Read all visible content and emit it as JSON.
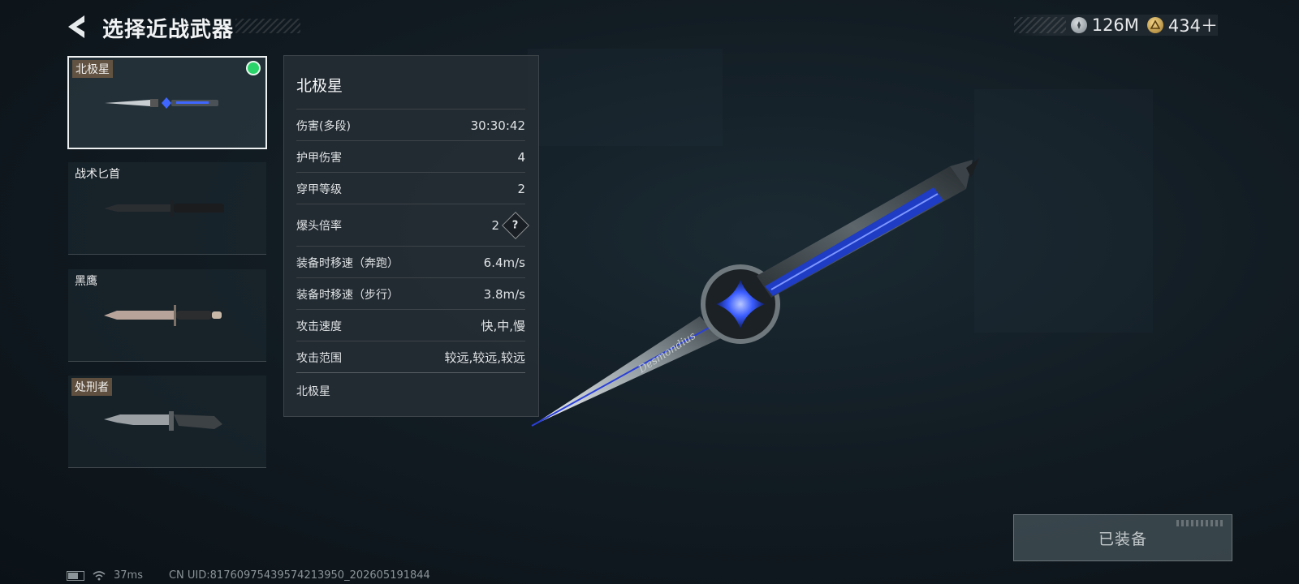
{
  "header": {
    "title": "选择近战武器"
  },
  "currency": [
    {
      "icon": "silver-coin-icon",
      "value": "126M"
    },
    {
      "icon": "gold-coin-icon",
      "value": "434＋"
    }
  ],
  "weapons": [
    {
      "name": "北极星",
      "selected": true,
      "equipped": true
    },
    {
      "name": "战术匕首",
      "selected": false,
      "equipped": false
    },
    {
      "name": "黑鹰",
      "selected": false,
      "equipped": false
    },
    {
      "name": "处刑者",
      "selected": false,
      "equipped": false
    }
  ],
  "stats_panel": {
    "title": "北极星",
    "rows": [
      {
        "label": "伤害(多段)",
        "value": "30:30:42"
      },
      {
        "label": "护甲伤害",
        "value": "4"
      },
      {
        "label": "穿甲等级",
        "value": "2"
      },
      {
        "label": "爆头倍率",
        "value": "2",
        "help": "?"
      },
      {
        "label": "装备时移速（奔跑）",
        "value": "6.4m/s"
      },
      {
        "label": "装备时移速（步行）",
        "value": "3.8m/s"
      },
      {
        "label": "攻击速度",
        "value": "快,中,慢"
      },
      {
        "label": "攻击范围",
        "value": "较远,较远,较远"
      }
    ],
    "footer": "北极星"
  },
  "knife_engraving": "Desmondius",
  "equip_button": {
    "label": "已装备"
  },
  "status_bar": {
    "ping": "37ms",
    "uid": "CN UID:8176097543957421395​0_202605191844"
  },
  "colors": {
    "equipped_dot": "#2bd46a",
    "accent_blue": "#3a5cff"
  }
}
